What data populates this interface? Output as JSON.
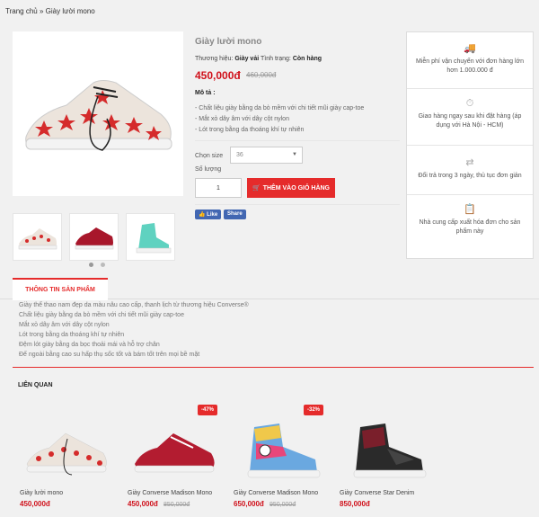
{
  "breadcrumb": {
    "home": "Trang chủ",
    "sep": "»",
    "current": "Giày lười mono"
  },
  "product": {
    "title": "Giày lười mono",
    "brand_label": "Thương hiệu:",
    "brand": "Giày vải",
    "status_label": "Tình trạng:",
    "status": "Còn hàng",
    "price": "450,000đ",
    "old_price": "460,000đ",
    "desc_title": "Mô tả :",
    "desc_items": [
      "- Chất liệu giày bằng da bò mềm với chi tiết mũi giày cap-toe",
      "- Mắt xỏ dây âm với dây cột nylon",
      "- Lót trong bằng da thoáng khí tự nhiên"
    ],
    "size_label": "Chọn size",
    "size_value": "36",
    "qty_label": "Số lượng",
    "qty_value": "1",
    "cart_button": "THÊM VÀO GIỎ HÀNG",
    "fb_like": "Like",
    "fb_share": "Share"
  },
  "side": [
    {
      "icon": "truck-icon",
      "text1": "Miễn phí vận chuyển với đơn hàng lớn",
      "text2": "hơn 1.000.000 đ"
    },
    {
      "icon": "stopwatch-icon",
      "text1": "Giao hàng ngay sau khi đặt hàng (áp",
      "text2": "dụng với Hà Nội - HCM)"
    },
    {
      "icon": "exchange-icon",
      "text1": "Đổi trả trong 3 ngày, thủ tục đơn giản",
      "text2": ""
    },
    {
      "icon": "clipboard-icon",
      "text1": "Nhà cung cấp xuất hóa đơn cho sản",
      "text2": "phẩm này"
    }
  ],
  "tab_label": "THÔNG TIN SẢN PHẨM",
  "info_lines": [
    "Giày thể thao nam đẹp da màu nâu cao cấp, thanh lịch từ thương hiệu Converse®",
    "Chất liệu giày bằng da bò mềm với chi tiết mũi giày cap-toe",
    "Mắt xỏ dây âm với dây cột nylon",
    "Lót trong bằng da thoáng khí tự nhiên",
    "Đệm lót giày bằng da bọc thoải mái và hỗ trợ chân",
    "Đế ngoài bằng cao su hấp thụ sốc tốt và bám tốt trên mọi bề mặt"
  ],
  "related_title": "LIÊN QUAN",
  "related": [
    {
      "name": "Giày lười mono",
      "price": "450,000đ",
      "old": "",
      "badge": ""
    },
    {
      "name": "Giày Converse Madison Mono",
      "price": "450,000đ",
      "old": "850,000đ",
      "badge": "-47%"
    },
    {
      "name": "Giày Converse Madison Mono",
      "price": "650,000đ",
      "old": "950,000đ",
      "badge": "-32%"
    },
    {
      "name": "Giày Converse Star Denim",
      "price": "850,000đ",
      "old": "",
      "badge": ""
    }
  ]
}
